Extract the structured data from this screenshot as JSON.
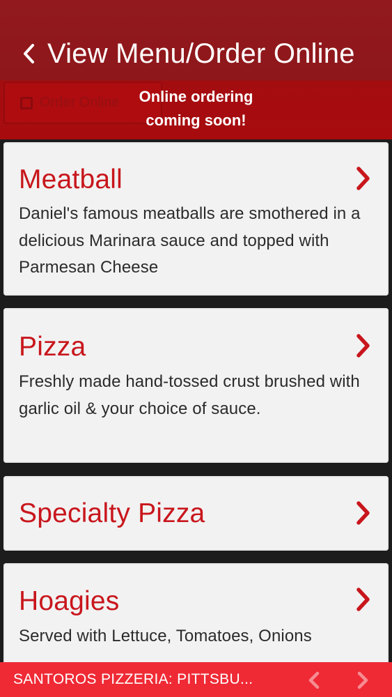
{
  "header": {
    "title": "View Menu/Order Online",
    "ghost_button_label": "Order Online",
    "notice_line1": "Online ordering",
    "notice_line2": "coming soon!"
  },
  "menu": [
    {
      "title": "Meatball",
      "description": "Daniel's famous meatballs are smothered in a delicious Marinara sauce and topped with Parmesan Cheese"
    },
    {
      "title": "Pizza",
      "description": "Freshly made hand-tossed crust brushed with garlic oil & your choice of sauce."
    },
    {
      "title": "Specialty Pizza",
      "description": ""
    },
    {
      "title": "Hoagies",
      "description": "Served with Lettuce, Tomatoes, Onions"
    }
  ],
  "bottom_bar": {
    "title": "SANTOROS PIZZERIA: PITTSBU..."
  },
  "icons": {
    "back": "chevron-left-icon",
    "item_arrow": "chevron-right-icon",
    "prev": "chevron-left-icon",
    "next": "chevron-right-icon"
  },
  "colors": {
    "header": "#921a1e",
    "notice_band": "#a80b0e",
    "accent_red": "#c8161c",
    "card_bg": "#f2f2f2",
    "bottom_bar": "#ef2a35"
  }
}
